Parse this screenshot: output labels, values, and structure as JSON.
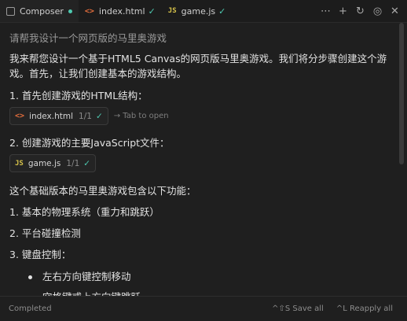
{
  "tabs": [
    {
      "label": "Composer",
      "icon": "composer-icon"
    },
    {
      "label": "index.html",
      "icon": "html-file-icon",
      "icon_text": "<>"
    },
    {
      "label": "game.js",
      "icon": "js-file-icon",
      "icon_text": "JS"
    }
  ],
  "tab_actions": [
    {
      "name": "more-options-icon",
      "glyph": "⋯"
    },
    {
      "name": "add-icon",
      "glyph": "+"
    },
    {
      "name": "history-icon",
      "glyph": "↻"
    },
    {
      "name": "settings-icon",
      "glyph": "◎"
    },
    {
      "name": "close-icon",
      "glyph": "✕"
    }
  ],
  "chat": {
    "prompt": "请帮我设计一个网页版的马里奥游戏",
    "intro": "我来帮您设计一个基于HTML5 Canvas的网页版马里奥游戏。我们将分步骤创建这个游戏。首先，让我们创建基本的游戏结构。",
    "step1": "1. 首先创建游戏的HTML结构：",
    "file1": {
      "name": "index.html",
      "count": "1/1",
      "icon_text": "<>",
      "hint": "→ Tab to open"
    },
    "step2": "2. 创建游戏的主要JavaScript文件：",
    "file2": {
      "name": "game.js",
      "count": "1/1",
      "icon_text": "JS"
    },
    "features_title": "这个基础版本的马里奥游戏包含以下功能：",
    "feature1": "1. 基本的物理系统（重力和跳跃）",
    "feature2": "2. 平台碰撞检测",
    "feature3": "3. 键盘控制：",
    "bullets": [
      "左右方向键控制移动",
      "空格键或上方向键跳跃"
    ]
  },
  "status": {
    "text": "Completed",
    "save_all": "^⇧S Save all",
    "reapply_all": "^L Reapply all"
  },
  "colors": {
    "accent": "#4ec9b0",
    "html_icon": "#e06c3c",
    "js_icon": "#d7c34a"
  }
}
